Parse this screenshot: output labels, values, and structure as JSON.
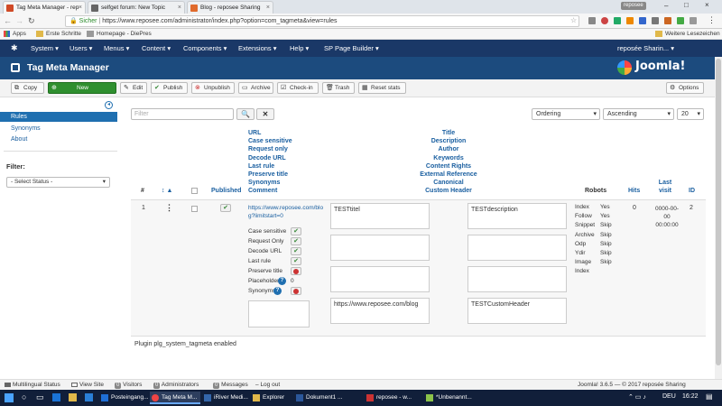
{
  "browser": {
    "user_chip": "reposee",
    "tabs": [
      {
        "title": "Tag Meta Manager - rep",
        "favicon_color": "#d04a27"
      },
      {
        "title": "selfget forum: New Topic",
        "favicon_color": "#666666"
      },
      {
        "title": "Blog - reposee Sharing",
        "favicon_color": "#e06a2c"
      }
    ],
    "secure_label": "Sicher",
    "url": "https://www.reposee.com/administrator/index.php?option=com_tagmeta&view=rules",
    "bookmarks": {
      "apps": "Apps",
      "items": [
        "Erste Schritte",
        "Homepage - DiePres"
      ],
      "other": "Weitere Lesezeichen"
    }
  },
  "joomla_nav": {
    "items": [
      "System",
      "Users",
      "Menus",
      "Content",
      "Components",
      "Extensions",
      "Help",
      "SP Page Builder"
    ],
    "user": "reposée Sharin..."
  },
  "header": {
    "title": "Tag Meta Manager",
    "logo_text": "Joomla!"
  },
  "toolbar": {
    "buttons": [
      "Copy",
      "New",
      "Edit",
      "Publish",
      "Unpublish",
      "Archive",
      "Check-in",
      "Trash",
      "Reset stats"
    ],
    "options": "Options"
  },
  "sidebar": {
    "items": [
      "Rules",
      "Synonyms",
      "About"
    ],
    "filter_label": "Filter:",
    "status_select": "- Select Status -"
  },
  "search": {
    "placeholder": "Filter"
  },
  "sort": {
    "ordering": "Ordering",
    "direction": "Ascending",
    "limit": "20"
  },
  "columns": {
    "number": "#",
    "order": "↕ ▲",
    "published": "Published",
    "rule_group": [
      "URL",
      "Case sensitive",
      "Request only",
      "Decode URL",
      "Last rule",
      "Preserve title",
      "Synonyms",
      "Comment"
    ],
    "meta_group": [
      "Title",
      "Description",
      "Author",
      "Keywords",
      "Content Rights",
      "External Reference",
      "Canonical",
      "Custom Header"
    ],
    "robots": "Robots",
    "hits": "Hits",
    "last_visit": "Last visit",
    "id": "ID"
  },
  "row": {
    "number": "1",
    "url": "https://www.reposee.com/blog?limitstart=0",
    "flags": [
      {
        "label": "Case sensitive",
        "state": "yes"
      },
      {
        "label": "Request Only",
        "state": "yes"
      },
      {
        "label": "Decode URL",
        "state": "yes"
      },
      {
        "label": "Last rule",
        "state": "yes"
      },
      {
        "label": "Preserve title",
        "state": "no"
      },
      {
        "label": "Placeholders",
        "state": "0"
      },
      {
        "label": "Synonyms",
        "state": "no"
      }
    ],
    "title": "TESTtitel",
    "description": "TESTdescription",
    "canonical": "https://www.reposee.com/blog",
    "custom_header": "TESTCustomHeader",
    "robots": [
      [
        "Index",
        "Yes"
      ],
      [
        "Follow",
        "Yes"
      ],
      [
        "Snippet",
        "Skip"
      ],
      [
        "Archive",
        "Skip"
      ],
      [
        "Odp",
        "Skip"
      ],
      [
        "Ydir",
        "Skip"
      ],
      [
        "Image",
        "Skip"
      ],
      [
        "Index",
        ""
      ]
    ],
    "hits": "0",
    "last_visit": "0000-00-00 00:00:00",
    "id": "2"
  },
  "footer_note": "Plugin plg_system_tagmeta enabled",
  "statusbar": {
    "items": [
      "Multilingual Status",
      "View Site",
      "Visitors",
      "Administrators",
      "Messages",
      "Log out"
    ],
    "counts": [
      "0",
      "0",
      "0"
    ],
    "version": "Joomla! 3.6.5 — © 2017 reposée Sharing"
  },
  "taskbar": {
    "items": [
      "Posteingang...",
      "Tag Meta M...",
      "iRiver Medi...",
      "Explorer",
      "Dokument1 ...",
      "reposee - w...",
      "*Unbenannt..."
    ],
    "lang": "DEU",
    "time": "16:22"
  }
}
